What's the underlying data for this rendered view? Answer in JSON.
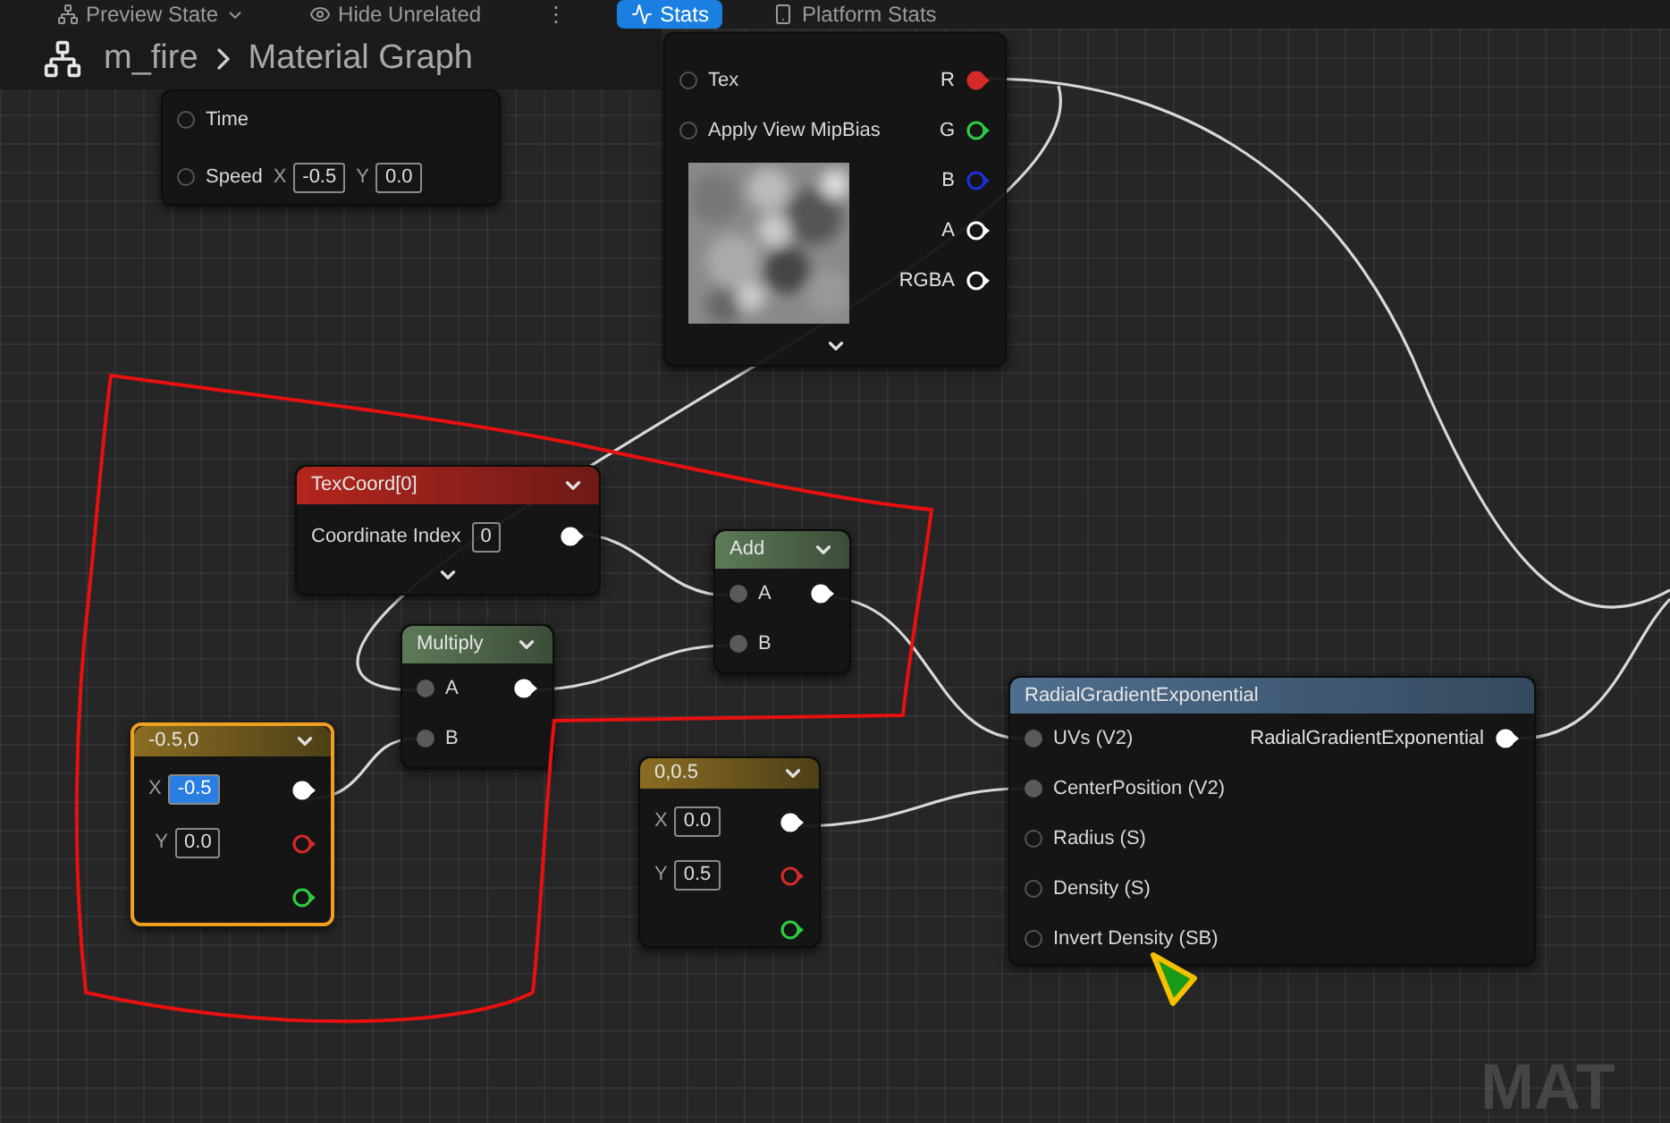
{
  "toolbar": {
    "items": [
      {
        "label": "Preview State",
        "kind": "dropdown",
        "selected": false
      },
      {
        "label": "Hide Unrelated",
        "kind": "toggle",
        "selected": false
      },
      {
        "label": "⋮",
        "kind": "menu",
        "selected": false
      },
      {
        "label": "Stats",
        "kind": "toggle",
        "selected": true
      },
      {
        "label": "Platform Stats",
        "kind": "toggle",
        "selected": false
      }
    ]
  },
  "breadcrumb": {
    "asset": "m_fire",
    "graph": "Material Graph"
  },
  "nodes": [
    {
      "kind": "panner",
      "selected": false,
      "inputs": [
        {
          "label": "Time",
          "connected": false
        },
        {
          "label": "Speed",
          "connected": false,
          "fields": [
            {
              "axis": "X",
              "value": "-0.5",
              "highlighted": false
            },
            {
              "axis": "Y",
              "value": "0.0",
              "highlighted": false
            }
          ]
        }
      ]
    },
    {
      "kind": "texture",
      "selected": false,
      "preview": true,
      "advanced_toggle": true,
      "inputs": [
        {
          "label": "Tex",
          "connected": false
        },
        {
          "label": "Apply View MipBias",
          "connected": false
        }
      ],
      "outputs": [
        {
          "label": "R",
          "color": "#d42a2a",
          "connected": true
        },
        {
          "label": "G",
          "color": "#2ecc40",
          "connected": false
        },
        {
          "label": "B",
          "color": "#1f2fd6",
          "connected": false
        },
        {
          "label": "A",
          "color": "#ffffff",
          "connected": false
        },
        {
          "label": "RGBA",
          "color": "#ffffff",
          "connected": false
        }
      ]
    },
    {
      "kind": "texcoord",
      "title": "TexCoord[0]",
      "selected": false,
      "advanced_toggle": true,
      "inputs": [
        {
          "label": "Coordinate Index",
          "fields": [
            {
              "value": "0",
              "highlighted": false
            }
          ]
        }
      ],
      "outputs": [
        {
          "color": "#ffffff",
          "connected": true
        }
      ]
    },
    {
      "kind": "math",
      "title": "Add",
      "selected": false,
      "inputs": [
        {
          "label": "A",
          "connected": true
        },
        {
          "label": "B",
          "connected": true
        }
      ],
      "outputs": [
        {
          "color": "#ffffff",
          "connected": true
        }
      ]
    },
    {
      "kind": "math",
      "title": "Multiply",
      "selected": false,
      "inputs": [
        {
          "label": "A",
          "connected": true
        },
        {
          "label": "B",
          "connected": true
        }
      ],
      "outputs": [
        {
          "color": "#ffffff",
          "connected": true
        }
      ]
    },
    {
      "kind": "constant",
      "title": "-0.5,0",
      "selected": true,
      "inputs": [
        {
          "fields": [
            {
              "axis": "X",
              "value": "-0.5",
              "highlighted": true
            }
          ]
        },
        {
          "fields": [
            {
              "axis": "Y",
              "value": "0.0",
              "highlighted": false
            }
          ]
        }
      ],
      "outputs": [
        {
          "color": "#ffffff",
          "connected": true
        },
        {
          "color": "#d42a2a",
          "connected": false
        },
        {
          "color": "#2ecc40",
          "connected": false
        }
      ]
    },
    {
      "kind": "constant",
      "title": "0,0.5",
      "selected": false,
      "inputs": [
        {
          "fields": [
            {
              "axis": "X",
              "value": "0.0",
              "highlighted": false
            }
          ]
        },
        {
          "fields": [
            {
              "axis": "Y",
              "value": "0.5",
              "highlighted": false
            }
          ]
        }
      ],
      "outputs": [
        {
          "color": "#ffffff",
          "connected": true
        },
        {
          "color": "#d42a2a",
          "connected": false
        },
        {
          "color": "#2ecc40",
          "connected": false
        }
      ]
    },
    {
      "kind": "function",
      "title": "RadialGradientExponential",
      "selected": false,
      "inputs": [
        {
          "label": "UVs (V2)",
          "connected": true
        },
        {
          "label": "CenterPosition (V2)",
          "connected": true
        },
        {
          "label": "Radius (S)",
          "connected": false
        },
        {
          "label": "Density (S)",
          "connected": false
        },
        {
          "label": "Invert Density (SB)",
          "connected": false
        }
      ],
      "outputs": [
        {
          "label": "RadialGradientExponential",
          "color": "#ffffff",
          "connected": true
        }
      ]
    }
  ],
  "canvas_label": "MAT"
}
